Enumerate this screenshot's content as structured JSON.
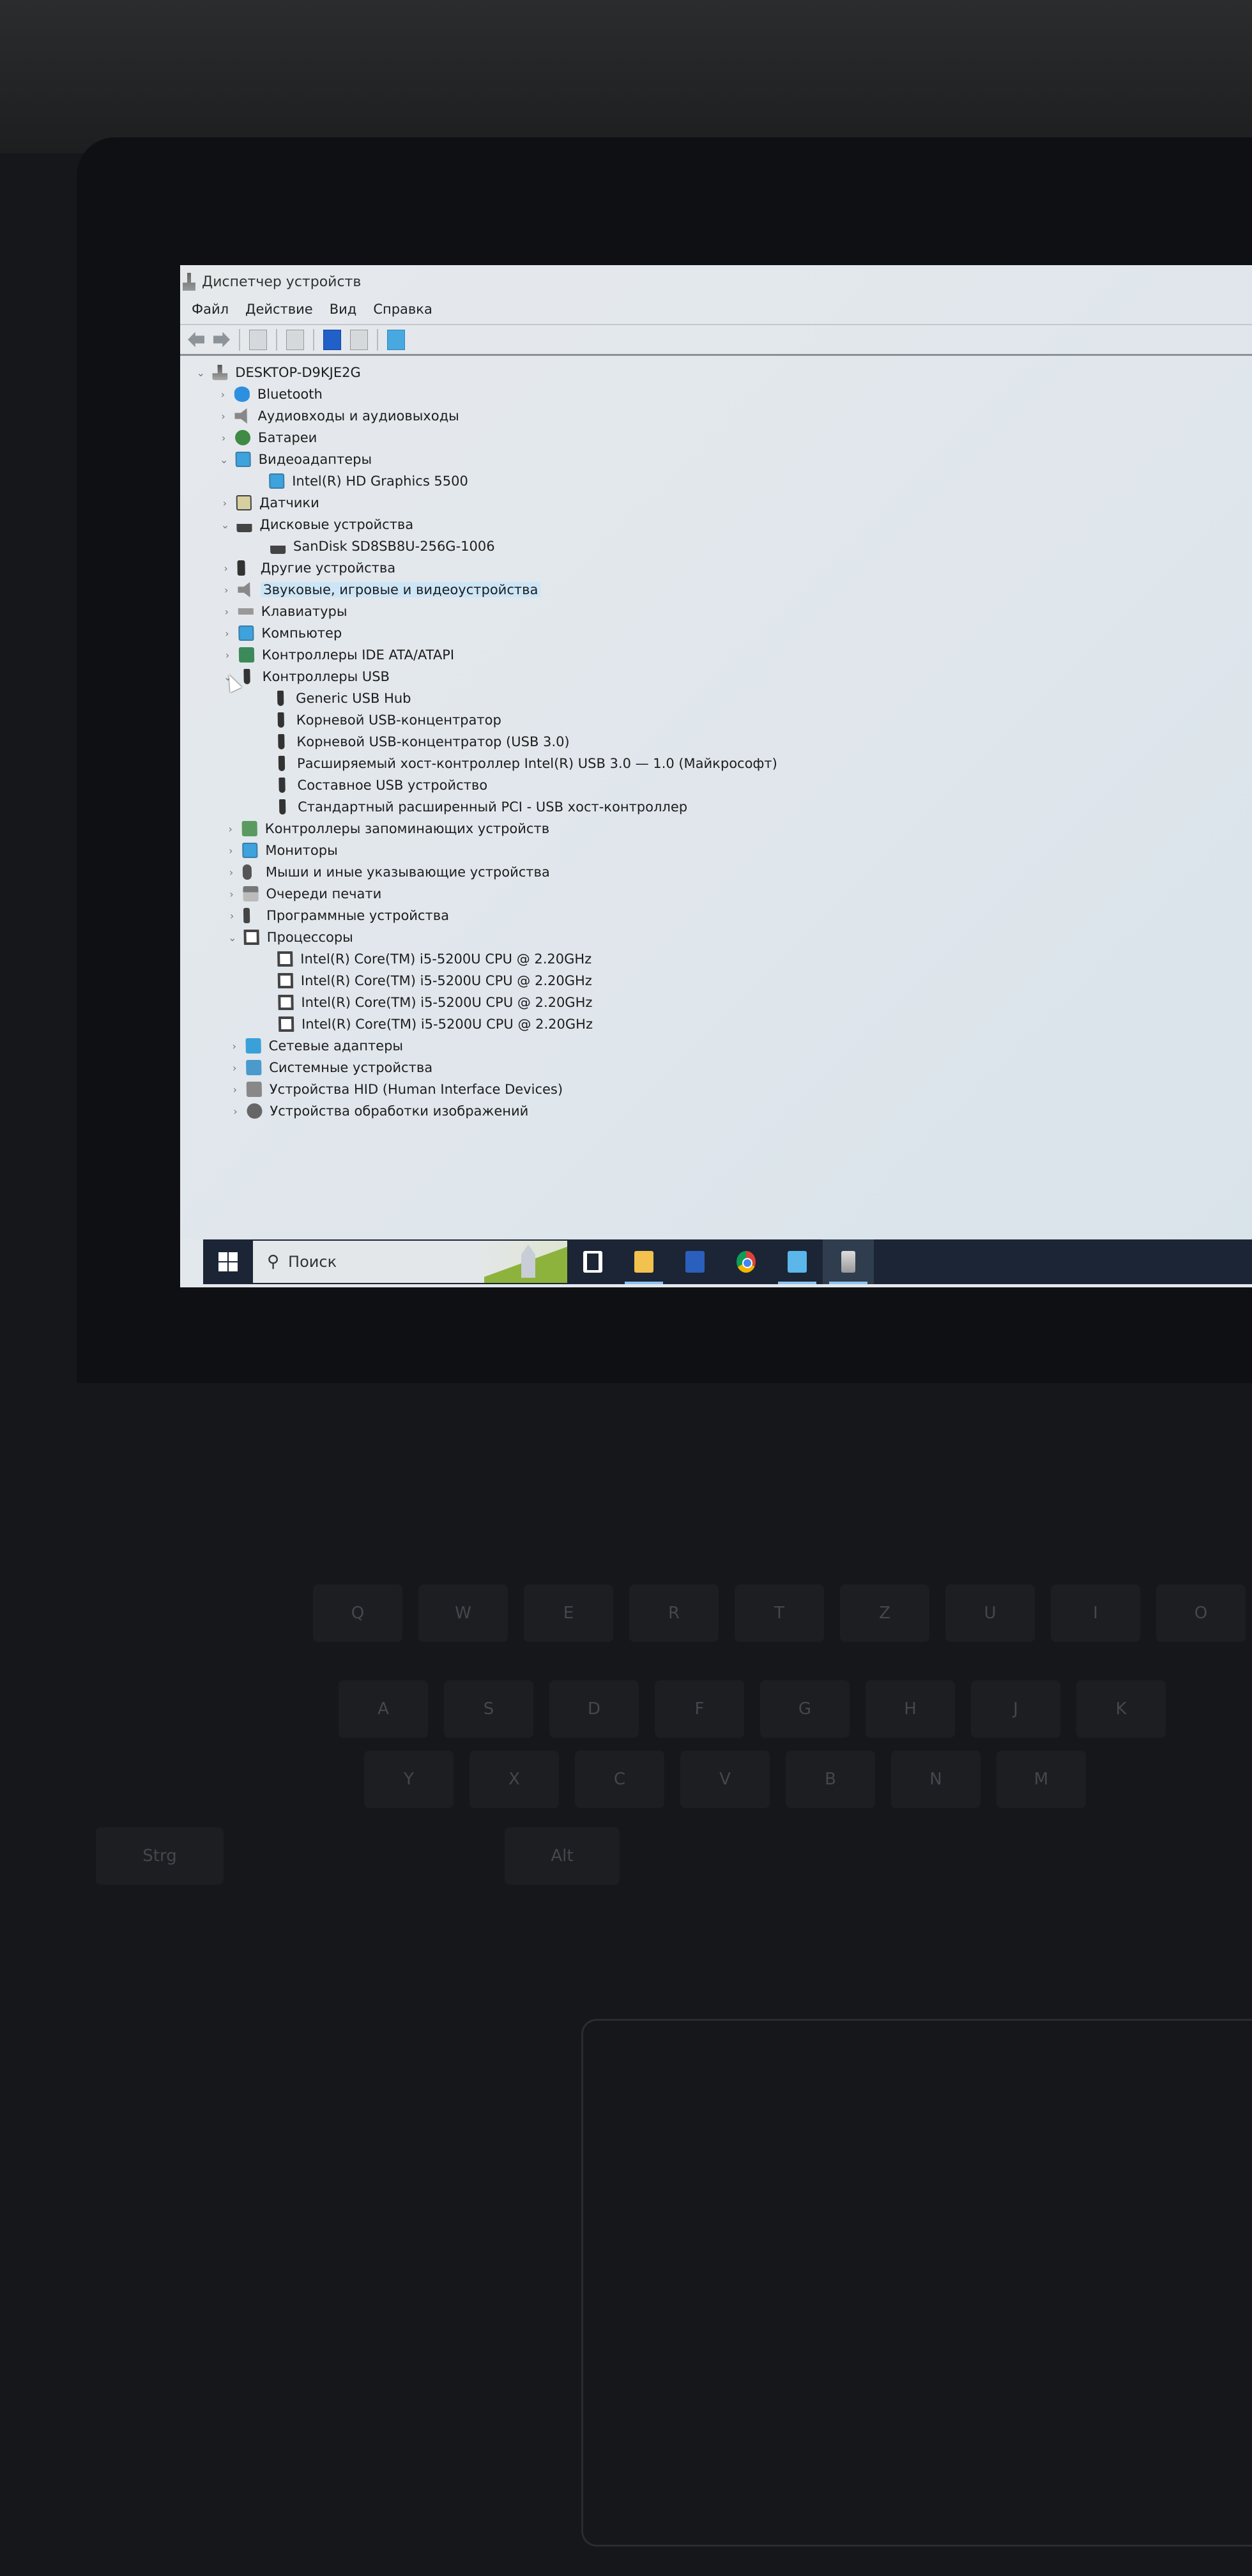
{
  "window": {
    "title": "Диспетчер устройств",
    "menu": [
      "Файл",
      "Действие",
      "Вид",
      "Справка"
    ],
    "toolbar_icons": [
      "back-arrow-icon",
      "forward-arrow-icon",
      "show-hide-console-tree-icon",
      "properties-icon",
      "help-icon",
      "action-pane-icon",
      "scan-hardware-icon"
    ]
  },
  "tree": [
    {
      "label": "DESKTOP-D9KJE2G",
      "level": 0,
      "state": "expanded",
      "icon": "computer"
    },
    {
      "label": "Bluetooth",
      "level": 1,
      "state": "collapsed",
      "icon": "bluetooth"
    },
    {
      "label": "Аудиовходы и аудиовыходы",
      "level": 1,
      "state": "collapsed",
      "icon": "audio"
    },
    {
      "label": "Батареи",
      "level": 1,
      "state": "collapsed",
      "icon": "battery"
    },
    {
      "label": "Видеоадаптеры",
      "level": 1,
      "state": "expanded",
      "icon": "display"
    },
    {
      "label": "Intel(R) HD Graphics 5500",
      "level": 2,
      "icon": "display"
    },
    {
      "label": "Датчики",
      "level": 1,
      "state": "collapsed",
      "icon": "sensor"
    },
    {
      "label": "Дисковые устройства",
      "level": 1,
      "state": "expanded",
      "icon": "disk"
    },
    {
      "label": "SanDisk SD8SB8U-256G-1006",
      "level": 2,
      "icon": "disk"
    },
    {
      "label": "Другие устройства",
      "level": 1,
      "state": "collapsed",
      "icon": "other"
    },
    {
      "label": "Звуковые, игровые и видеоустройства",
      "level": 1,
      "state": "collapsed",
      "icon": "audio",
      "selected": true
    },
    {
      "label": "Клавиатуры",
      "level": 1,
      "state": "collapsed",
      "icon": "keyboard"
    },
    {
      "label": "Компьютер",
      "level": 1,
      "state": "collapsed",
      "icon": "display"
    },
    {
      "label": "Контроллеры IDE ATA/ATAPI",
      "level": 1,
      "state": "collapsed",
      "icon": "ide"
    },
    {
      "label": "Контроллеры USB",
      "level": 1,
      "state": "expanded",
      "icon": "usb"
    },
    {
      "label": "Generic USB Hub",
      "level": 2,
      "icon": "usb"
    },
    {
      "label": "Корневой USB-концентратор",
      "level": 2,
      "icon": "usb"
    },
    {
      "label": "Корневой USB-концентратор (USB 3.0)",
      "level": 2,
      "icon": "usb"
    },
    {
      "label": "Расширяемый хост-контроллер Intel(R) USB 3.0 — 1.0 (Майкрософт)",
      "level": 2,
      "icon": "usb"
    },
    {
      "label": "Составное USB устройство",
      "level": 2,
      "icon": "usb"
    },
    {
      "label": "Стандартный расширенный PCI - USB хост-контроллер",
      "level": 2,
      "icon": "usb"
    },
    {
      "label": "Контроллеры запоминающих устройств",
      "level": 1,
      "state": "collapsed",
      "icon": "storage"
    },
    {
      "label": "Мониторы",
      "level": 1,
      "state": "collapsed",
      "icon": "display"
    },
    {
      "label": "Мыши и иные указывающие устройства",
      "level": 1,
      "state": "collapsed",
      "icon": "mouse"
    },
    {
      "label": "Очереди печати",
      "level": 1,
      "state": "collapsed",
      "icon": "printer"
    },
    {
      "label": "Программные устройства",
      "level": 1,
      "state": "collapsed",
      "icon": "firmware"
    },
    {
      "label": "Процессоры",
      "level": 1,
      "state": "expanded",
      "icon": "cpu"
    },
    {
      "label": "Intel(R) Core(TM) i5-5200U CPU @ 2.20GHz",
      "level": 2,
      "icon": "cpu"
    },
    {
      "label": "Intel(R) Core(TM) i5-5200U CPU @ 2.20GHz",
      "level": 2,
      "icon": "cpu"
    },
    {
      "label": "Intel(R) Core(TM) i5-5200U CPU @ 2.20GHz",
      "level": 2,
      "icon": "cpu"
    },
    {
      "label": "Intel(R) Core(TM) i5-5200U CPU @ 2.20GHz",
      "level": 2,
      "icon": "cpu"
    },
    {
      "label": "Сетевые адаптеры",
      "level": 1,
      "state": "collapsed",
      "icon": "network"
    },
    {
      "label": "Системные устройства",
      "level": 1,
      "state": "collapsed",
      "icon": "system"
    },
    {
      "label": "Устройства HID (Human Interface Devices)",
      "level": 1,
      "state": "collapsed",
      "icon": "hid"
    },
    {
      "label": "Устройства обработки изображений",
      "level": 1,
      "state": "collapsed",
      "icon": "imaging"
    }
  ],
  "taskbar": {
    "search_placeholder": "Поиск",
    "apps": [
      {
        "name": "task-view",
        "running": false,
        "active": false
      },
      {
        "name": "file-explorer",
        "running": true,
        "active": false
      },
      {
        "name": "word",
        "running": false,
        "active": false
      },
      {
        "name": "chrome",
        "running": false,
        "active": false
      },
      {
        "name": "control-panel",
        "running": true,
        "active": false
      },
      {
        "name": "device-manager",
        "running": true,
        "active": true
      }
    ]
  },
  "colors": {
    "selection": "#cde6f7",
    "taskbar": "#1b2535",
    "running_indicator": "#8fc3f0"
  },
  "keyboard_keys": [
    "Q",
    "W",
    "E",
    "R",
    "T",
    "Z",
    "U",
    "I",
    "O",
    "A",
    "S",
    "D",
    "F",
    "G",
    "H",
    "J",
    "K",
    "Y",
    "X",
    "C",
    "V",
    "B",
    "N",
    "M",
    "Strg",
    "Alt"
  ]
}
